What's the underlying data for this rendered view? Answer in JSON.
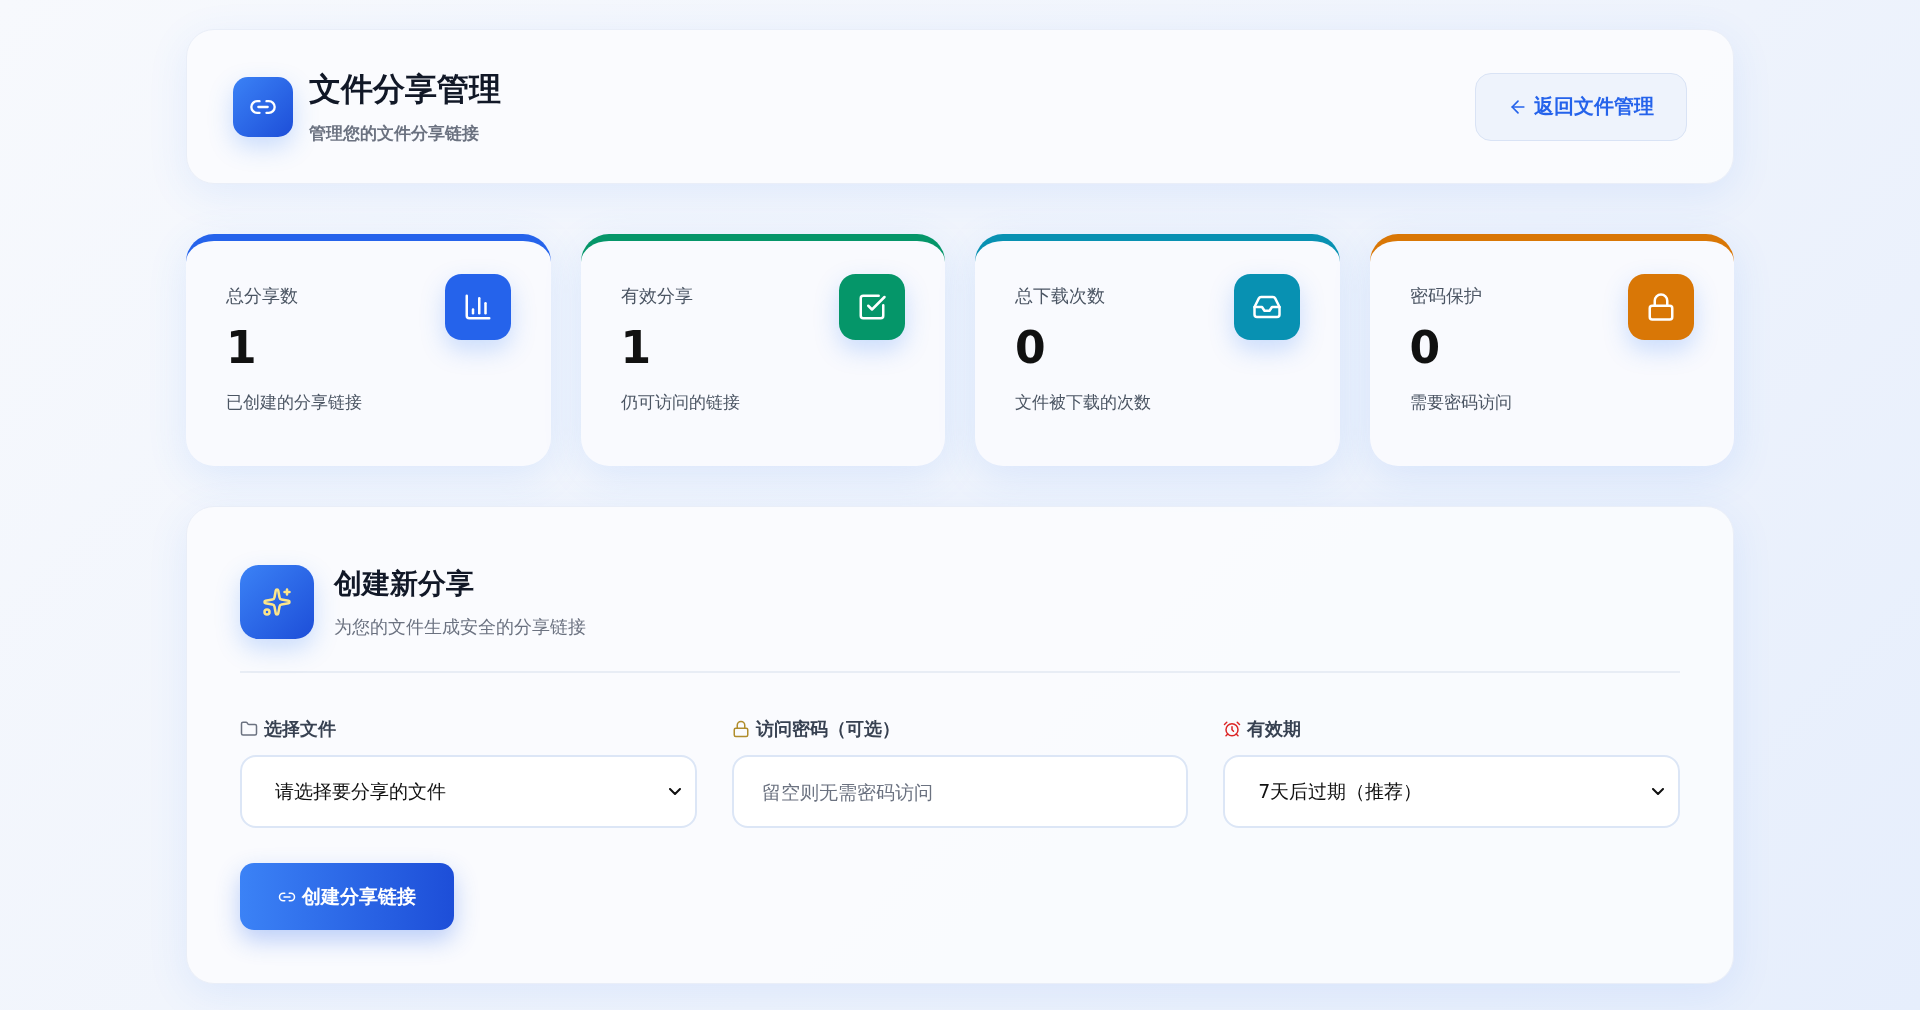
{
  "header": {
    "title": "文件分享管理",
    "subtitle": "管理您的文件分享链接",
    "back_button": "返回文件管理"
  },
  "stats": [
    {
      "kind": "chart",
      "label": "总分享数",
      "value": "1",
      "caption": "已创建的分享链接",
      "color": "#2563eb"
    },
    {
      "kind": "check",
      "label": "有效分享",
      "value": "1",
      "caption": "仍可访问的链接",
      "color": "#059669"
    },
    {
      "kind": "inbox",
      "label": "总下载次数",
      "value": "0",
      "caption": "文件被下载的次数",
      "color": "#0891b2"
    },
    {
      "kind": "lock",
      "label": "密码保护",
      "value": "0",
      "caption": "需要密码访问",
      "color": "#d97706"
    }
  ],
  "create_share": {
    "title": "创建新分享",
    "subtitle": "为您的文件生成安全的分享链接",
    "fields": [
      {
        "kind": "select",
        "label": "选择文件",
        "value": "请选择要分享的文件"
      },
      {
        "kind": "input",
        "label": "访问密码（可选）",
        "placeholder": "留空则无需密码访问"
      },
      {
        "kind": "select",
        "label": "有效期",
        "value": "7天后过期（推荐）"
      }
    ],
    "submit_button": "创建分享链接"
  }
}
